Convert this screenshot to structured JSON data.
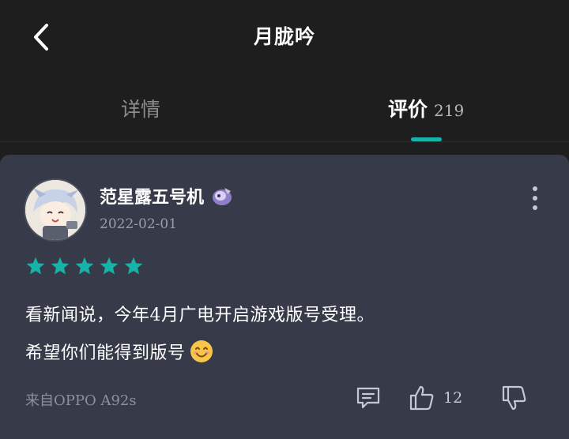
{
  "header": {
    "back_icon": "chevron-left-icon",
    "title": "月胧吟"
  },
  "tabs": [
    {
      "label": "详情",
      "active": false
    },
    {
      "label": "评价",
      "count": "219",
      "active": true
    }
  ],
  "colors": {
    "accent": "#17b3a8",
    "card_bg": "#363a49",
    "page_bg": "#1e1e1e"
  },
  "review": {
    "username": "范星露五号机",
    "date": "2022-02-01",
    "rating": 5,
    "text_lines": [
      "看新闻说，今年4月广电开启游戏版号受理。",
      "希望你们能得到版号"
    ],
    "device": "来自OPPO A92s",
    "like_count": "12",
    "icons": [
      "more-vertical-icon",
      "comment-icon",
      "thumbs-up-icon",
      "thumbs-down-icon"
    ]
  }
}
